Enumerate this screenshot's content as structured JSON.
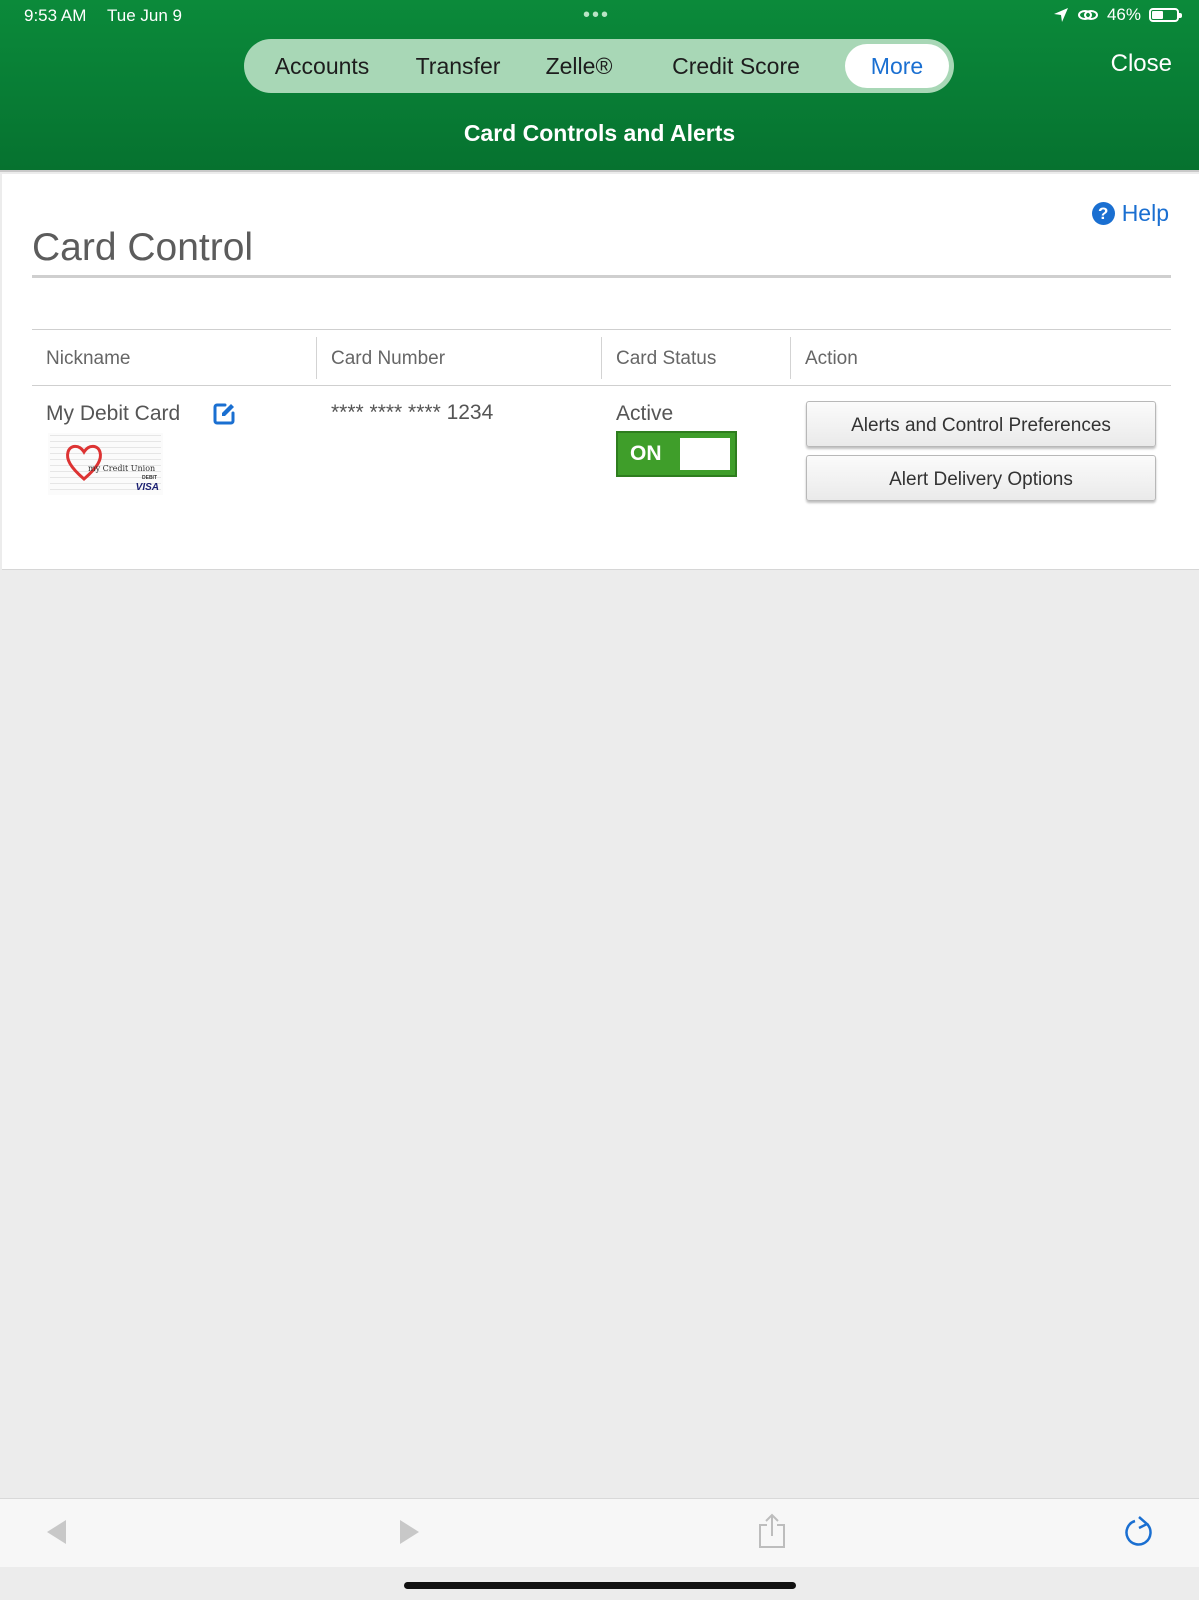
{
  "status_bar": {
    "time": "9:53 AM",
    "date": "Tue Jun 9",
    "battery_percent": "46%",
    "battery_level": 0.46,
    "icons": [
      "location-arrow-icon",
      "link-icon",
      "battery-icon"
    ]
  },
  "nav": {
    "tabs": [
      {
        "label": "Accounts"
      },
      {
        "label": "Transfer"
      },
      {
        "label": "Zelle®"
      },
      {
        "label": "Credit Score"
      },
      {
        "label": "More",
        "active": true
      }
    ],
    "close_label": "Close"
  },
  "page": {
    "subtitle": "Card Controls and Alerts",
    "help_label": "Help",
    "section_title": "Card Control"
  },
  "table": {
    "headers": [
      "Nickname",
      "Card Number",
      "Card Status",
      "Action"
    ],
    "rows": [
      {
        "nickname": "My Debit Card",
        "card_number": "**** **** **** 1234",
        "status": "Active",
        "toggle_label": "ON",
        "toggle_on": true,
        "card_image": {
          "caption": "my Credit Union",
          "brand": "VISA",
          "type": "DEBIT"
        },
        "actions": [
          "Alerts and Control Preferences",
          "Alert Delivery Options"
        ]
      }
    ]
  },
  "toolbar": {
    "icons": [
      "back-arrow-icon",
      "forward-arrow-icon",
      "share-icon",
      "reload-icon"
    ]
  },
  "colors": {
    "header_green": "#0b8a3a",
    "pill_green": "#a8d7b6",
    "link_blue": "#1a6fd1",
    "toggle_green": "#3f9e2a",
    "background_gray": "#ececec"
  }
}
